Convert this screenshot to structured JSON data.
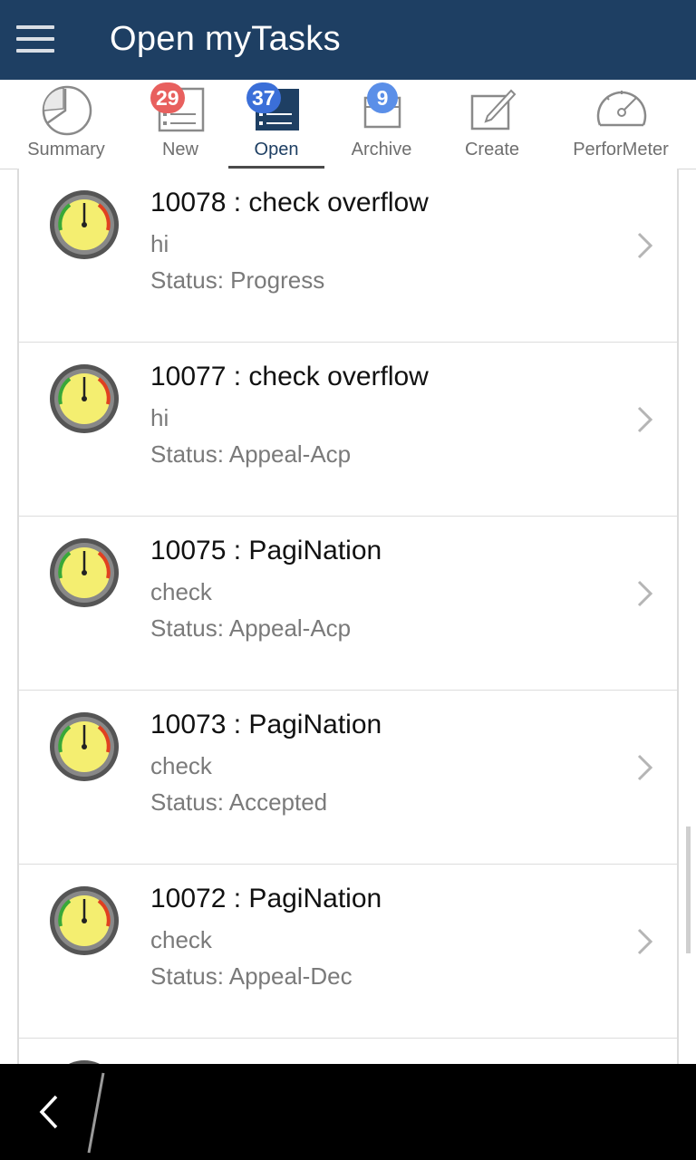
{
  "header": {
    "title": "Open myTasks",
    "bg_color": "#1e3f63"
  },
  "tabs": [
    {
      "label": "Summary",
      "icon": "pie-chart-icon",
      "badge": ""
    },
    {
      "label": "New",
      "icon": "list-icon",
      "badge": "29",
      "badge_color": "#e8605e"
    },
    {
      "label": "Open",
      "icon": "open-list-icon",
      "badge": "37",
      "badge_color": "#3b6fd8",
      "active": true
    },
    {
      "label": "Archive",
      "icon": "archive-box-icon",
      "badge": "9",
      "badge_color": "#5b8fe8"
    },
    {
      "label": "Create",
      "icon": "edit-icon",
      "badge": ""
    },
    {
      "label": "PerforMeter",
      "icon": "speedometer-icon",
      "badge": ""
    }
  ],
  "tasks": [
    {
      "title": "10078 : check overflow",
      "description": "hi",
      "status": "Status: Progress"
    },
    {
      "title": "10077 : check overflow",
      "description": "hi",
      "status": "Status: Appeal-Acp"
    },
    {
      "title": "10075 : PagiNation",
      "description": "check",
      "status": "Status: Appeal-Acp"
    },
    {
      "title": "10073 : PagiNation",
      "description": "check",
      "status": "Status: Accepted"
    },
    {
      "title": "10072 : PagiNation",
      "description": "check",
      "status": "Status: Appeal-Dec"
    }
  ]
}
